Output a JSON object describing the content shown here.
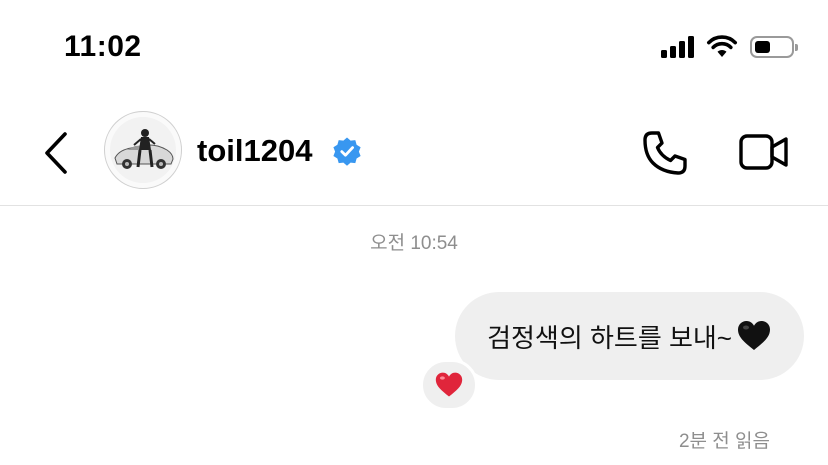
{
  "status_bar": {
    "time": "11:02",
    "icons": [
      "cellular-signal-icon",
      "wifi-icon",
      "battery-icon"
    ],
    "battery_level": 0.45
  },
  "header": {
    "back_icon": "chevron-left-icon",
    "username": "toil1204",
    "verified": true,
    "verified_color": "#3897f0",
    "call_icon": "phone-icon",
    "video_icon": "video-camera-icon"
  },
  "chat": {
    "timestamp": "오전 10:54",
    "messages": [
      {
        "text": "검정색의 하트를 보내~",
        "emoji": "black-heart",
        "outgoing": true,
        "bubble_color": "#efefef",
        "reaction": "red-heart"
      }
    ],
    "read_receipt": "2분 전 읽음"
  },
  "colors": {
    "meta_text": "#8e8e8e",
    "reaction_heart": "#e0253b",
    "divider": "#e2e2e2"
  }
}
